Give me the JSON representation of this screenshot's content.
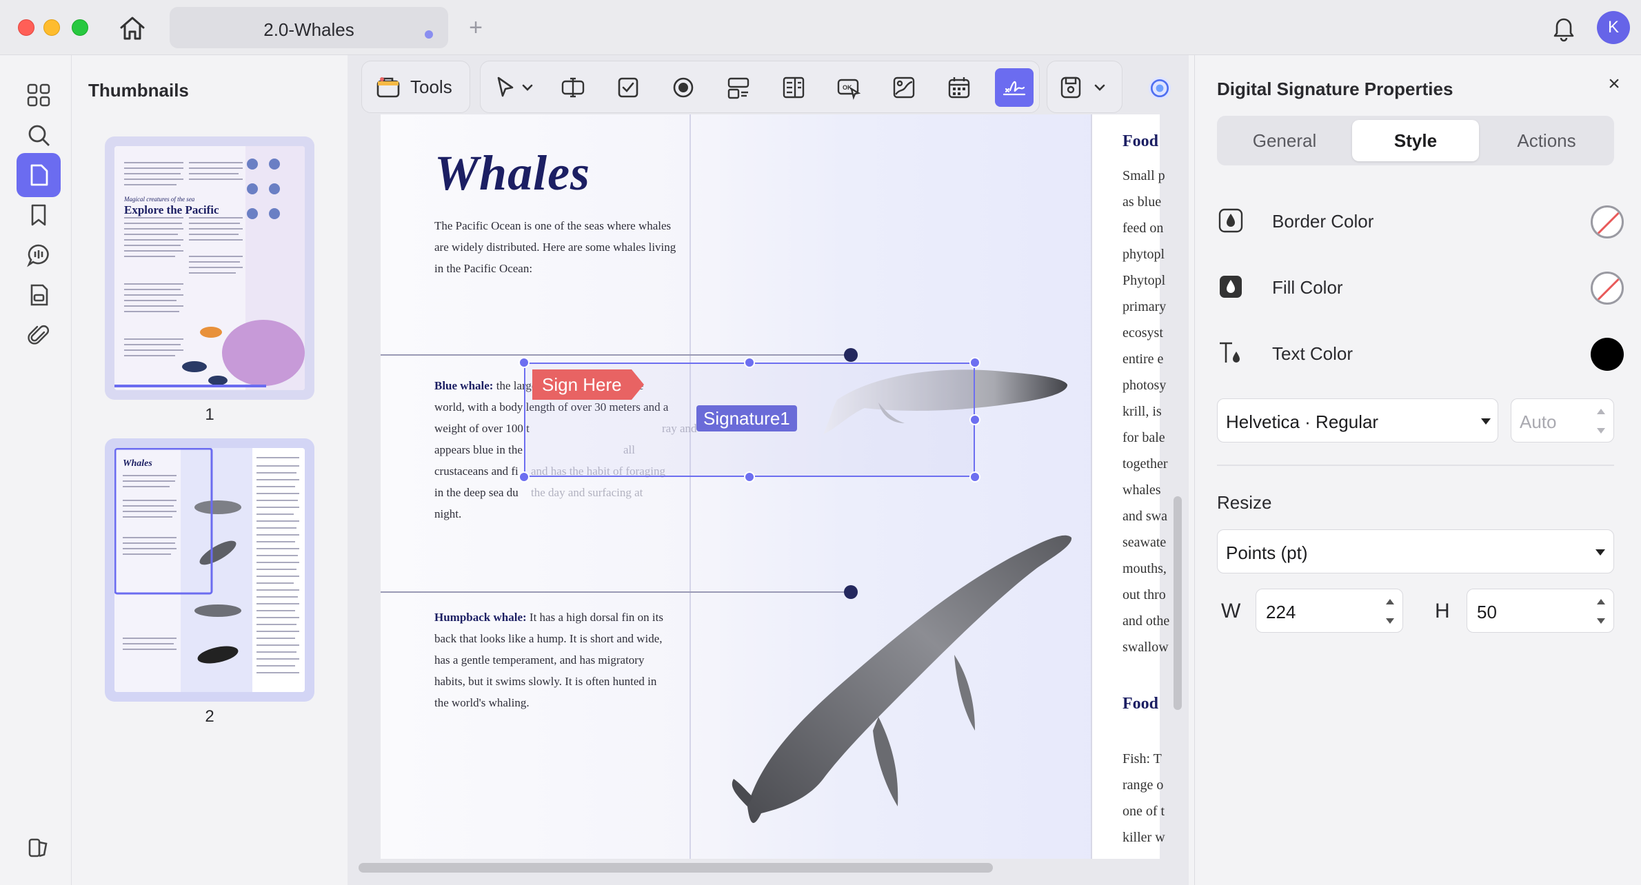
{
  "titlebar": {
    "tab_title": "2.0-Whales",
    "new_tab": "+",
    "avatar_initial": "K"
  },
  "rail": {
    "items": [
      {
        "name": "grid",
        "icon": "grid-icon"
      },
      {
        "name": "search",
        "icon": "search-icon"
      },
      {
        "name": "pages",
        "icon": "page-icon",
        "active": true
      },
      {
        "name": "bookmarks",
        "icon": "bookmark-icon"
      },
      {
        "name": "comments",
        "icon": "comment-icon"
      },
      {
        "name": "forms",
        "icon": "form-icon"
      },
      {
        "name": "attachments",
        "icon": "paperclip-icon"
      },
      {
        "name": "theme",
        "icon": "theme-icon"
      }
    ]
  },
  "thumbnails": {
    "heading": "Thumbnails",
    "pages": [
      {
        "number": "1",
        "subtitle": "Magical creatures of the sea",
        "title": "Explore the Pacific"
      },
      {
        "number": "2",
        "title": "Whales",
        "selected": true
      }
    ]
  },
  "toolbar": {
    "tools_label": "Tools"
  },
  "document": {
    "title": "Whales",
    "intro": "The Pacific Ocean is one of the seas where whales are widely distributed. Here are some whales living in the Pacific Ocean:",
    "blue_whale_label": "Blue whale:",
    "blue_whale_lines": [
      " the largest known animal in the",
      "world, with a body length of over 30 meters and a",
      "weight of over 100 t",
      "appears blue in the",
      "crustaceans and fi",
      "in the deep sea du",
      "night."
    ],
    "blue_whale_faded": [
      "ray and",
      "all",
      "and has the habit of foraging",
      "the day and surfacing at"
    ],
    "humpback_label": "Humpback whale:",
    "humpback_lines": [
      " It has a high dorsal fin on its",
      "back that looks like a hump. It is short and wide,",
      "has a gentle temperament, and has migratory",
      "habits, but it swims slowly. It is often hunted in",
      "the world's whaling."
    ],
    "right_col_heading_1": "Food",
    "right_col_heading_2": "Food",
    "right_col_lines": [
      "Small p",
      "as blue",
      "feed on",
      "phytopl",
      "Phytopl",
      "primary",
      "ecosyst",
      "entire e",
      "photosy",
      "krill, is",
      "for bale",
      "together",
      "whales",
      "and swa",
      "seawate",
      "mouths,",
      "out thro",
      "and othe",
      "swallow"
    ],
    "right_col_lines_2": [
      "Fish: T",
      "range o",
      "one of t",
      "killer w"
    ],
    "sign_here": "Sign Here",
    "signature_field": "Signature1"
  },
  "properties": {
    "title": "Digital Signature Properties",
    "tabs": [
      "General",
      "Style",
      "Actions"
    ],
    "active_tab": "Style",
    "border_color_label": "Border Color",
    "fill_color_label": "Fill Color",
    "text_color_label": "Text Color",
    "text_color": "#000000",
    "font": "Helvetica · Regular",
    "font_size_placeholder": "Auto",
    "resize_label": "Resize",
    "unit": "Points (pt)",
    "width_label": "W",
    "width": "224",
    "height_label": "H",
    "height": "50"
  },
  "colors": {
    "accent": "#6b6cf0",
    "title_navy": "#1c1f63",
    "sign_here": "#e86363"
  }
}
